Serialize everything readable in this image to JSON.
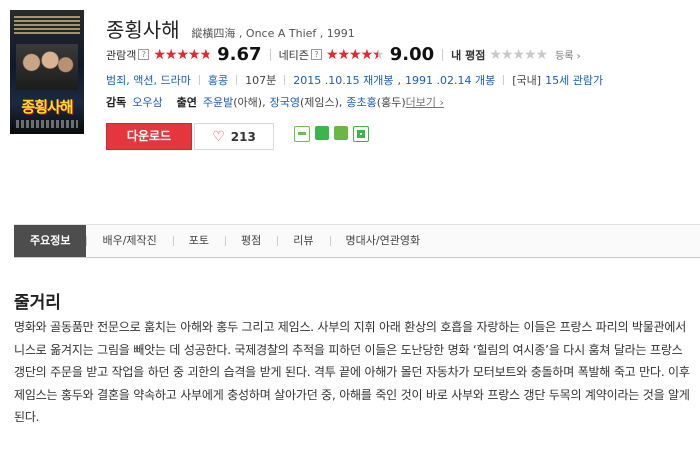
{
  "poster": {
    "title_text": "종횡사해"
  },
  "movie": {
    "title": "종횡사해",
    "original_title": "縱橫四海 , Once A Thief , 1991"
  },
  "ratings": {
    "audience": {
      "label": "관람객",
      "help": "?",
      "score_text": "9.67",
      "fill": 0.967
    },
    "netizen": {
      "label": "네티즌",
      "help": "?",
      "score_text": "9.00",
      "fill": 0.9
    },
    "mine": {
      "label": "내 평점",
      "fill": 0,
      "register_label": "등록 ›"
    }
  },
  "info": {
    "genres": "범죄, 액션, 드라마",
    "country": "홍콩",
    "runtime": "107분",
    "release_1": "2015 .10.15 재개봉",
    "release_2": "1991 .02.14 개봉",
    "rating_prefix": "[국내]",
    "rating": "15세 관람가"
  },
  "credits": {
    "director_label": "감독",
    "director": "오우삼",
    "cast_label": "출연",
    "cast_1": "주윤발",
    "cast_1_role": "(아해),",
    "cast_2": "장국영",
    "cast_2_role": "(제임스),",
    "cast_3": "종초홍",
    "cast_3_role": "(홍두)",
    "more": "더보기 ›"
  },
  "actions": {
    "download": "다운로드",
    "like_count": "213"
  },
  "share_icons": [
    "blog-icon",
    "line-icon",
    "band-icon",
    "cafe-icon"
  ],
  "tabs": [
    "주요정보",
    "배우/제작진",
    "포토",
    "평점",
    "리뷰",
    "명대사/연관영화"
  ],
  "section": {
    "title": "줄거리",
    "text": "명화와 골동품만 전문으로 훔치는 아해와 홍두 그리고 제임스. 사부의 지휘 아래 환상의 호흡을 자랑하는 이들은 프랑스 파리의 박물관에서 니스로 옮겨지는 그림을 빼앗는 데 성공한다. 국제경찰의 추적을 피하던 이들은 도난당한 명화 ‘힐림의 여시종’을 다시 훔쳐 달라는 프랑스 갱단의 주문을 받고 작업을 하던 중 괴한의 습격을 받게 된다. 격투 끝에 아해가 몰던 자동차가 모터보트와 충돌하며 폭발해 죽고 만다. 이후 제임스는 홍두와 결혼을 약속하고 사부에게 충성하며 살아가던 중, 아해를 죽인 것이 바로 사부와 프랑스 갱단 두목의 계약이라는 것을 알게 된다."
  },
  "colors": {
    "accent": "#e4363d",
    "star": "#e7262e",
    "link": "#1a5fb4",
    "tab_active": "#4d4d4d"
  }
}
